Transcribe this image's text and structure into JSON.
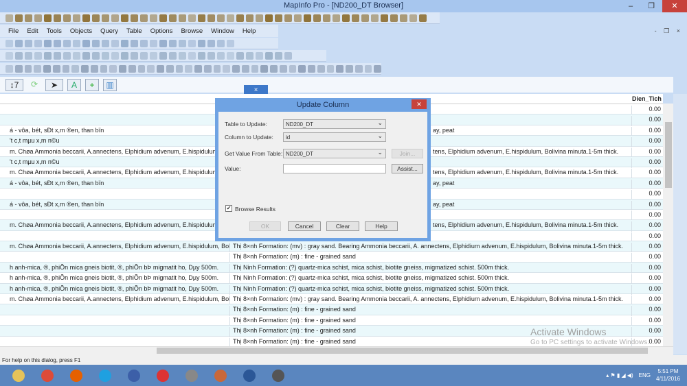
{
  "window": {
    "title": "MapInfo Pro - [ND200_DT Browser]",
    "minimize": "–",
    "restore": "❐",
    "close": "✕"
  },
  "menu": [
    "File",
    "Edit",
    "Tools",
    "Objects",
    "Query",
    "Table",
    "Options",
    "Browse",
    "Window",
    "Help"
  ],
  "mdi_controls": "- ❐ ×",
  "toolbars": {
    "draw": {
      "count": 44,
      "color": "#8a6a2a"
    },
    "standard": {
      "count": 24,
      "color": "#8fa8c8"
    },
    "main": {
      "count": 30,
      "color": "#9ab0c8"
    },
    "edit": {
      "count": 40,
      "color": "#8fa0b8"
    }
  },
  "browser_toolbar": {
    "sort_icon": "↕7",
    "refresh_icon": "⟳",
    "select_icon": "➤",
    "text_icon": "A",
    "add_icon": "+",
    "columns_icon": "▥"
  },
  "floating_window_close": "×",
  "grid": {
    "column_header": "Dien_Tich",
    "rows": [
      {
        "c1": "",
        "c2": "",
        "clip": false,
        "v": "0.00"
      },
      {
        "c1": "",
        "c2": "",
        "clip": false,
        "v": "0.00"
      },
      {
        "c1": "á - vôa, bét, sÐt x,m ®en, than bïn",
        "c2": "ay, peat",
        "clip": true,
        "v": "0.00"
      },
      {
        "c1": "'t c,t mµu x,m n©u",
        "c2": "",
        "clip": true,
        "v": "0.00"
      },
      {
        "c1": "m. Chøa   Ammonia beccarii,  A.annectens, Elphidium advenum, E.hispidulum",
        "c2": "tens, Elphidium advenum, E.hispidulum, Bolivina minuta.1-5m thick.",
        "clip": true,
        "v": "0.00"
      },
      {
        "c1": "'t c,t mµu x,m n©u",
        "c2": "",
        "clip": true,
        "v": "0.00"
      },
      {
        "c1": "m. Chøa   Ammonia beccarii,  A.annectens, Elphidium advenum, E.hispidulum",
        "c2": "tens, Elphidium advenum, E.hispidulum, Bolivina minuta.1-5m thick.",
        "clip": true,
        "v": "0.00"
      },
      {
        "c1": "á - vôa, bét, sÐt x,m ®en, than bïn",
        "c2": "ay, peat",
        "clip": true,
        "v": "0.00"
      },
      {
        "c1": "",
        "c2": "",
        "clip": true,
        "v": "0.00"
      },
      {
        "c1": "á - vôa, bét, sÐt x,m ®en, than bïn",
        "c2": "ay, peat",
        "clip": true,
        "v": "0.00"
      },
      {
        "c1": "",
        "c2": "",
        "clip": true,
        "v": "0.00"
      },
      {
        "c1": "m. Chøa   Ammonia beccarii,  A.annectens, Elphidium advenum, E.hispidulum",
        "c2": "tens, Elphidium advenum, E.hispidulum, Bolivina minuta.1-5m thick.",
        "clip": true,
        "v": "0.00"
      },
      {
        "c1": "",
        "c2": "",
        "clip": true,
        "v": "0.00"
      },
      {
        "c1": "m. Chøa   Ammonia beccarii,  A.annectens, Elphidium advenum, E.hispidulum, Bolivina",
        "c2": "Thị 8×nh Formation: (mv) : gray sand. Bearing Ammonia beccarii, A. annectens, Elphidium advenum, E.hispidulum, Bolivina minuta.1-5m thick.",
        "clip": false,
        "v": "0.00"
      },
      {
        "c1": "",
        "c2": "Thị 8×nh Formation: (m) : fine - grained sand",
        "clip": false,
        "v": "0.00"
      },
      {
        "c1": "h anh-mica, ®, phiÕn mica gneis biotit, ®, phiÕn bÞ migmatit ho, Dµy 500m.",
        "c2": "Thị Ninh Formation: (?) quartz-mica schist, mica schist, biotite gneiss, migmatized schist. 500m thick.",
        "clip": false,
        "v": "0.00"
      },
      {
        "c1": "h anh-mica, ®, phiÕn mica gneis biotit, ®, phiÕn bÞ migmatit ho, Dµy 500m.",
        "c2": "Thị Ninh Formation: (?) quartz-mica schist, mica schist, biotite gneiss, migmatized schist. 500m thick.",
        "clip": false,
        "v": "0.00"
      },
      {
        "c1": "h anh-mica, ®, phiÕn mica gneis biotit, ®, phiÕn bÞ migmatit ho, Dµy 500m.",
        "c2": "Thị Ninh Formation: (?) quartz-mica schist, mica schist, biotite gneiss, migmatized schist. 500m thick.",
        "clip": false,
        "v": "0.00"
      },
      {
        "c1": "m. Chøa   Ammonia beccarii,  A.annectens, Elphidium advenum, E.hispidulum, Bolivina",
        "c2": "Thị 8×nh Formation: (mv) : gray sand. Bearing Ammonia beccarii, A. annectens, Elphidium advenum, E.hispidulum, Bolivina minuta.1-5m thick.",
        "clip": false,
        "v": "0.00"
      },
      {
        "c1": "",
        "c2": "Thị 8×nh Formation: (m) : fine - grained sand",
        "clip": false,
        "v": "0.00"
      },
      {
        "c1": "",
        "c2": "Thị 8×nh Formation: (m) : fine - grained sand",
        "clip": false,
        "v": "0.00"
      },
      {
        "c1": "",
        "c2": "Thị 8×nh Formation: (m) : fine - grained sand",
        "clip": false,
        "v": "0.00"
      },
      {
        "c1": "",
        "c2": "Thị 8×nh Formation: (m) : fine - grained sand",
        "clip": false,
        "v": "0.00"
      }
    ]
  },
  "dialog": {
    "title": "Update Column",
    "close": "✕",
    "table_label": "Table to Update:",
    "table_value": "ND200_DT",
    "column_label": "Column to Update:",
    "column_value": "id",
    "from_label": "Get Value From Table:",
    "from_value": "ND200_DT",
    "join": "Join...",
    "value_label": "Value:",
    "value": "",
    "assist": "Assist...",
    "browse_label": "Browse Results",
    "browse_checked": true,
    "ok": "OK",
    "cancel": "Cancel",
    "clear": "Clear",
    "help": "Help"
  },
  "watermark": {
    "title": "Activate Windows",
    "subtitle": "Go to PC settings to activate Windows."
  },
  "status": "For help on this dialog, press F1",
  "taskbar": {
    "apps": [
      {
        "name": "file-explorer",
        "color": "#e6c35a"
      },
      {
        "name": "chrome",
        "color": "#dd4b39"
      },
      {
        "name": "firefox",
        "color": "#e66000"
      },
      {
        "name": "internet-explorer",
        "color": "#1fa0e0"
      },
      {
        "name": "mapinfo",
        "color": "#3c5fa8"
      },
      {
        "name": "solitaire",
        "color": "#d33"
      },
      {
        "name": "globe-app",
        "color": "#888"
      },
      {
        "name": "office-app",
        "color": "#c8683a"
      },
      {
        "name": "word",
        "color": "#2b5797"
      },
      {
        "name": "media-player",
        "color": "#555"
      }
    ],
    "lang": "ENG",
    "time": "5:51 PM",
    "date": "4/11/2016"
  }
}
